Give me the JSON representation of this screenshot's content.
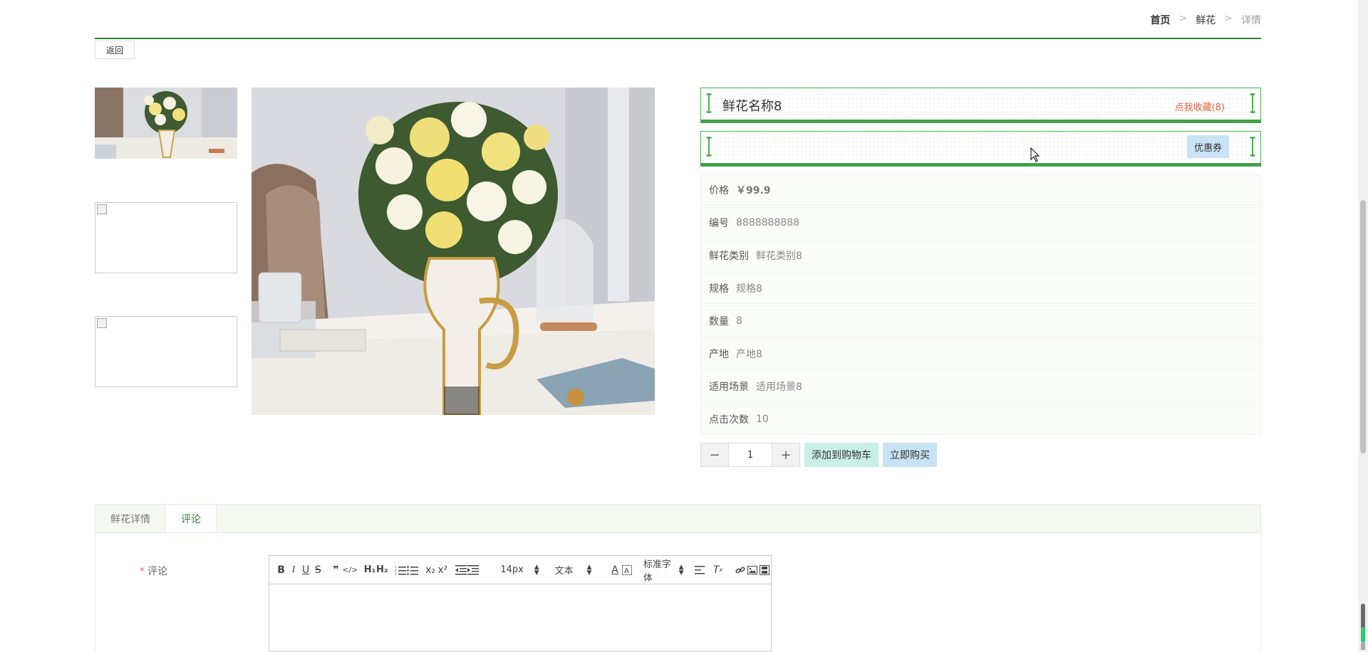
{
  "breadcrumb": {
    "home": "首页",
    "category": "鲜花",
    "current": "详情",
    "separator": ">"
  },
  "back_label": "返回",
  "product": {
    "name": "鲜花名称8",
    "favorite_label": "点我收藏(8)",
    "coupon_label": "优惠券",
    "fields": [
      {
        "label": "价格",
        "value": "￥99.9"
      },
      {
        "label": "编号",
        "value": "8888888888"
      },
      {
        "label": "鲜花类别",
        "value": "鲜花类别8"
      },
      {
        "label": "规格",
        "value": "规格8"
      },
      {
        "label": "数量",
        "value": "8"
      },
      {
        "label": "产地",
        "value": "产地8"
      },
      {
        "label": "适用场景",
        "value": "适用场景8"
      },
      {
        "label": "点击次数",
        "value": "10"
      }
    ]
  },
  "purchase": {
    "quantity": "1",
    "minus": "−",
    "plus": "+",
    "add_to_cart": "添加到购物车",
    "buy_now": "立即购买"
  },
  "tabs": [
    {
      "label": "鲜花详情"
    },
    {
      "label": "评论"
    }
  ],
  "comment_form": {
    "required_mark": "*",
    "label": "评论",
    "toolbar": {
      "font_size": "14px",
      "text_style": "文本",
      "font_family": "标准字体"
    }
  }
}
